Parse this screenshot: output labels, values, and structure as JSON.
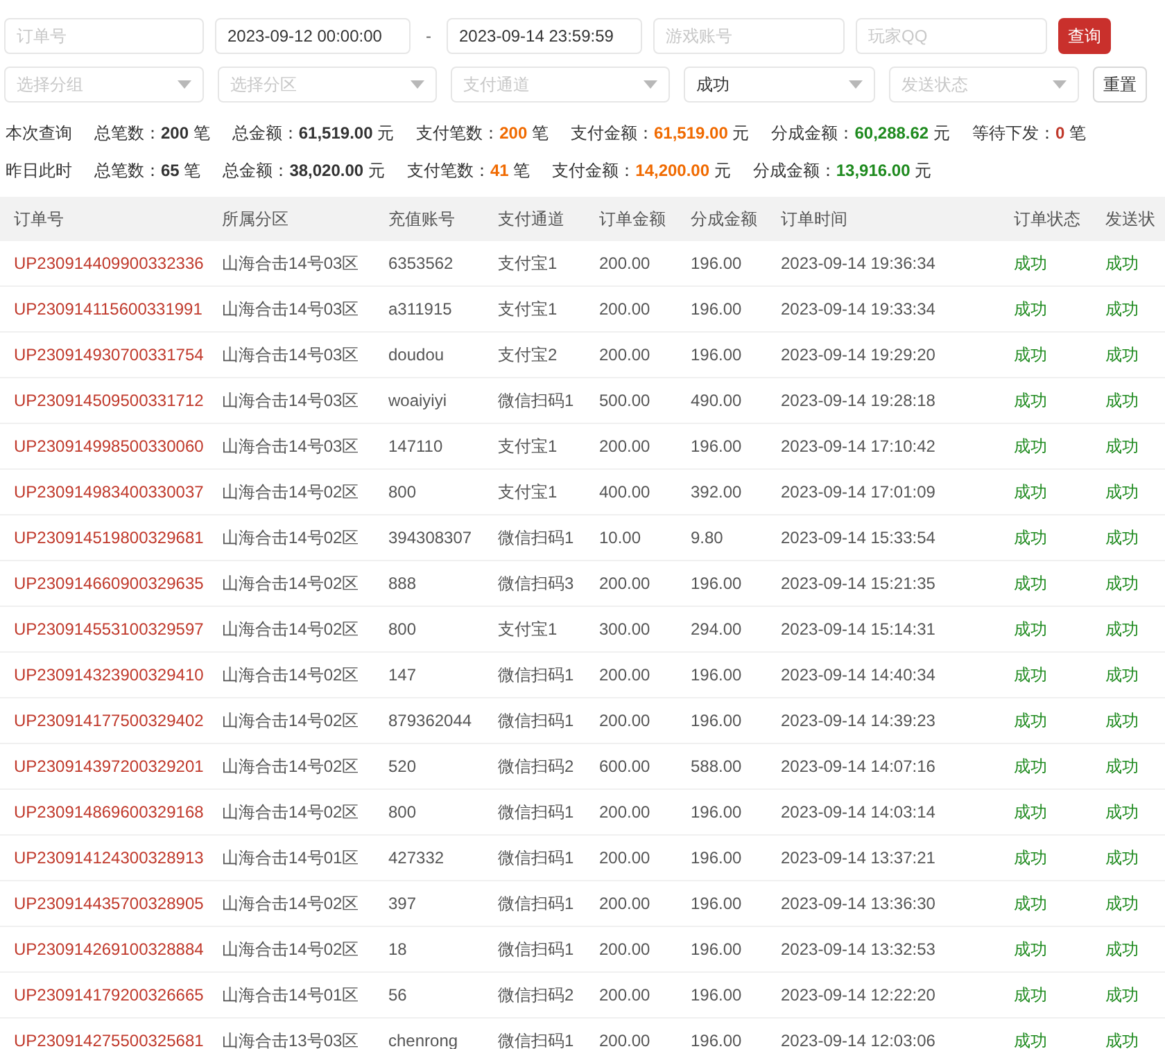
{
  "filters": {
    "row1": [
      {
        "kind": "input",
        "placeholder": "订单号"
      },
      {
        "kind": "input",
        "value": "2023-09-12 00:00:00"
      },
      {
        "kind": "sep",
        "text": "-"
      },
      {
        "kind": "input",
        "value": "2023-09-14 23:59:59"
      },
      {
        "kind": "input",
        "placeholder": "游戏账号"
      },
      {
        "kind": "input",
        "placeholder": "玩家QQ"
      },
      {
        "kind": "button",
        "text": "查询",
        "primary": true
      }
    ],
    "row2": [
      {
        "kind": "select",
        "placeholder": "选择分组"
      },
      {
        "kind": "select",
        "placeholder": "选择分区"
      },
      {
        "kind": "select",
        "placeholder": "支付通道"
      },
      {
        "kind": "select",
        "value": "成功"
      },
      {
        "kind": "select",
        "placeholder": "发送状态"
      },
      {
        "kind": "button",
        "text": "重置",
        "primary": false
      }
    ]
  },
  "stats": [
    {
      "label": "本次查询",
      "items": [
        {
          "label": "总笔数：",
          "value": "200",
          "unit": "笔",
          "color": "#333333"
        },
        {
          "label": "总金额：",
          "value": "61,519.00",
          "unit": "元",
          "color": "#333333"
        },
        {
          "label": "支付笔数：",
          "value": "200",
          "unit": "笔",
          "color": "#f06a00"
        },
        {
          "label": "支付金额：",
          "value": "61,519.00",
          "unit": "元",
          "color": "#f06a00"
        },
        {
          "label": "分成金额：",
          "value": "60,288.62",
          "unit": "元",
          "color": "#1e8a1e"
        },
        {
          "label": "等待下发：",
          "value": "0",
          "unit": "笔",
          "color": "#c0392b"
        }
      ]
    },
    {
      "label": "昨日此时",
      "items": [
        {
          "label": "总笔数：",
          "value": "65",
          "unit": "笔",
          "color": "#333333"
        },
        {
          "label": "总金额：",
          "value": "38,020.00",
          "unit": "元",
          "color": "#333333"
        },
        {
          "label": "支付笔数：",
          "value": "41",
          "unit": "笔",
          "color": "#f06a00"
        },
        {
          "label": "支付金额：",
          "value": "14,200.00",
          "unit": "元",
          "color": "#f06a00"
        },
        {
          "label": "分成金额：",
          "value": "13,916.00",
          "unit": "元",
          "color": "#1e8a1e"
        }
      ]
    }
  ],
  "table": {
    "columns": [
      "订单号",
      "所属分区",
      "充值账号",
      "支付通道",
      "订单金额",
      "分成金额",
      "订单时间",
      "订单状态",
      "发送状"
    ],
    "rows": [
      [
        "UP230914409900332336",
        "山海合击14号03区",
        "6353562",
        "支付宝1",
        "200.00",
        "196.00",
        "2023-09-14 19:36:34",
        "成功",
        "成功"
      ],
      [
        "UP230914115600331991",
        "山海合击14号03区",
        "a311915",
        "支付宝1",
        "200.00",
        "196.00",
        "2023-09-14 19:33:34",
        "成功",
        "成功"
      ],
      [
        "UP230914930700331754",
        "山海合击14号03区",
        "doudou",
        "支付宝2",
        "200.00",
        "196.00",
        "2023-09-14 19:29:20",
        "成功",
        "成功"
      ],
      [
        "UP230914509500331712",
        "山海合击14号03区",
        "woaiyiyi",
        "微信扫码1",
        "500.00",
        "490.00",
        "2023-09-14 19:28:18",
        "成功",
        "成功"
      ],
      [
        "UP230914998500330060",
        "山海合击14号03区",
        "147110",
        "支付宝1",
        "200.00",
        "196.00",
        "2023-09-14 17:10:42",
        "成功",
        "成功"
      ],
      [
        "UP230914983400330037",
        "山海合击14号02区",
        "800",
        "支付宝1",
        "400.00",
        "392.00",
        "2023-09-14 17:01:09",
        "成功",
        "成功"
      ],
      [
        "UP230914519800329681",
        "山海合击14号02区",
        "394308307",
        "微信扫码1",
        "10.00",
        "9.80",
        "2023-09-14 15:33:54",
        "成功",
        "成功"
      ],
      [
        "UP230914660900329635",
        "山海合击14号02区",
        "888",
        "微信扫码3",
        "200.00",
        "196.00",
        "2023-09-14 15:21:35",
        "成功",
        "成功"
      ],
      [
        "UP230914553100329597",
        "山海合击14号02区",
        "800",
        "支付宝1",
        "300.00",
        "294.00",
        "2023-09-14 15:14:31",
        "成功",
        "成功"
      ],
      [
        "UP230914323900329410",
        "山海合击14号02区",
        "147",
        "微信扫码1",
        "200.00",
        "196.00",
        "2023-09-14 14:40:34",
        "成功",
        "成功"
      ],
      [
        "UP230914177500329402",
        "山海合击14号02区",
        "879362044",
        "微信扫码1",
        "200.00",
        "196.00",
        "2023-09-14 14:39:23",
        "成功",
        "成功"
      ],
      [
        "UP230914397200329201",
        "山海合击14号02区",
        "520",
        "微信扫码2",
        "600.00",
        "588.00",
        "2023-09-14 14:07:16",
        "成功",
        "成功"
      ],
      [
        "UP230914869600329168",
        "山海合击14号02区",
        "800",
        "微信扫码1",
        "200.00",
        "196.00",
        "2023-09-14 14:03:14",
        "成功",
        "成功"
      ],
      [
        "UP230914124300328913",
        "山海合击14号01区",
        "427332",
        "微信扫码1",
        "200.00",
        "196.00",
        "2023-09-14 13:37:21",
        "成功",
        "成功"
      ],
      [
        "UP230914435700328905",
        "山海合击14号02区",
        "397",
        "微信扫码1",
        "200.00",
        "196.00",
        "2023-09-14 13:36:30",
        "成功",
        "成功"
      ],
      [
        "UP230914269100328884",
        "山海合击14号02区",
        "18",
        "微信扫码1",
        "200.00",
        "196.00",
        "2023-09-14 13:32:53",
        "成功",
        "成功"
      ],
      [
        "UP230914179200326665",
        "山海合击14号01区",
        "56",
        "微信扫码2",
        "200.00",
        "196.00",
        "2023-09-14 12:22:20",
        "成功",
        "成功"
      ],
      [
        "UP230914275500325681",
        "山海合击13号03区",
        "chenrong",
        "微信扫码1",
        "200.00",
        "196.00",
        "2023-09-14 12:03:06",
        "成功",
        "成功"
      ]
    ]
  }
}
